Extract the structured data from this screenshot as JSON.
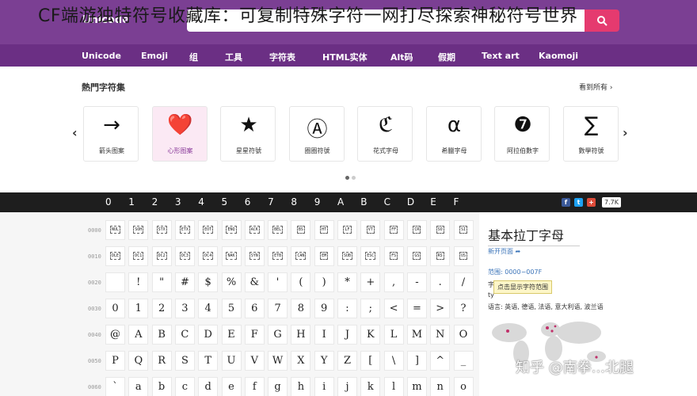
{
  "overlay_title": "CF端游独特符号收藏库：可复制特殊字符一网打尽探索神秘符号世界",
  "header": {
    "logo": "Unicode",
    "search_placeholder": ""
  },
  "nav": [
    "Unicode",
    "Emoji",
    "组",
    "工具",
    "字符表",
    "HTML实体",
    "Alt码",
    "假期",
    "Text art",
    "Kaomoji"
  ],
  "popular": {
    "title": "熱門字符集",
    "see_all": "看到所有 ›",
    "cards": [
      {
        "symbol": "→",
        "label": "箭头图案"
      },
      {
        "symbol": "❤️",
        "label": "心形图案",
        "active": true
      },
      {
        "symbol": "★",
        "label": "星星符號"
      },
      {
        "symbol": "Ⓐ",
        "label": "圈圈符號"
      },
      {
        "symbol": "ℭ",
        "label": "花式字母"
      },
      {
        "symbol": "α",
        "label": "希臘字母"
      },
      {
        "symbol": "❼",
        "label": "阿拉伯數字"
      },
      {
        "symbol": "∑",
        "label": "數學符號"
      }
    ]
  },
  "hex_headers": [
    "0",
    "1",
    "2",
    "3",
    "4",
    "5",
    "6",
    "7",
    "8",
    "9",
    "A",
    "B",
    "C",
    "D",
    "E",
    "F"
  ],
  "share_count": "7.7K",
  "rows": [
    {
      "label": "0000",
      "ctrl": true,
      "cells": [
        "NUL",
        "SOH",
        "STX",
        "ETX",
        "EOT",
        "ENQ",
        "ACK",
        "BEL",
        "BS",
        "HT",
        "LF",
        "VT",
        "FF",
        "CR",
        "SO",
        "SI"
      ]
    },
    {
      "label": "0010",
      "ctrl": true,
      "cells": [
        "DLE",
        "DC1",
        "DC2",
        "DC3",
        "DC4",
        "NAK",
        "SYN",
        "ETB",
        "CAN",
        "EM",
        "SUB",
        "ESC",
        "FS",
        "GS",
        "RS",
        "US"
      ]
    },
    {
      "label": "0020",
      "ctrl": false,
      "cells": [
        "",
        "!",
        "\"",
        "#",
        "$",
        "%",
        "&",
        "'",
        "(",
        ")",
        "*",
        "+",
        ",",
        "-",
        ".",
        "/"
      ]
    },
    {
      "label": "0030",
      "ctrl": false,
      "cells": [
        "0",
        "1",
        "2",
        "3",
        "4",
        "5",
        "6",
        "7",
        "8",
        "9",
        ":",
        ";",
        "<",
        "=",
        ">",
        "?"
      ]
    },
    {
      "label": "0040",
      "ctrl": false,
      "cells": [
        "@",
        "A",
        "B",
        "C",
        "D",
        "E",
        "F",
        "G",
        "H",
        "I",
        "J",
        "K",
        "L",
        "M",
        "N",
        "O"
      ]
    },
    {
      "label": "0050",
      "ctrl": false,
      "cells": [
        "P",
        "Q",
        "R",
        "S",
        "T",
        "U",
        "V",
        "W",
        "X",
        "Y",
        "Z",
        "[",
        "\\",
        "]",
        "^",
        "_"
      ]
    },
    {
      "label": "0060",
      "ctrl": false,
      "cells": [
        "`",
        "a",
        "b",
        "c",
        "d",
        "e",
        "f",
        "g",
        "h",
        "i",
        "j",
        "k",
        "l",
        "m",
        "n",
        "o"
      ]
    }
  ],
  "info": {
    "title": "基本拉丁字母",
    "link": "新开页面",
    "range": "范围: 0000−007F",
    "line2": "字",
    "line3": "ty",
    "tooltip": "点击显示字符范围",
    "langs": "语言: 英语, 德语, 法语, 意大利语, 波兰语"
  },
  "watermark": "知乎 @南拳...北腿",
  "colors": {
    "header": "#7b3f93",
    "nav": "#6b2f84",
    "search_button": "#e53a6f",
    "hex_bar": "#1e1e1e",
    "link": "#3a73b8"
  }
}
